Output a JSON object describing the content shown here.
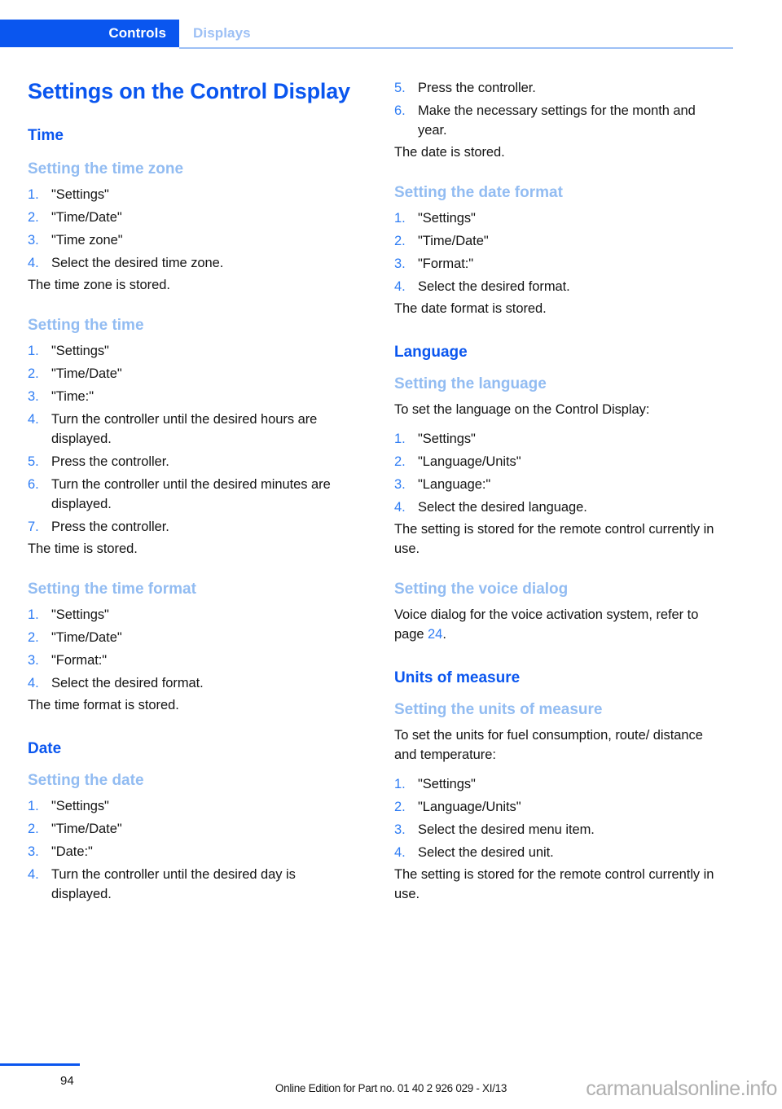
{
  "header": {
    "active_tab": "Controls",
    "inactive_tab": "Displays"
  },
  "colors": {
    "accent_blue": "#0a56ef",
    "light_blue": "#92bcf2",
    "number_blue": "#2f7df4",
    "body_text": "#141414",
    "watermark_gray": "#b0b0b0"
  },
  "title": "Settings on the Control Display",
  "left_column": {
    "section_time": "Time",
    "sub_time_zone": {
      "heading": "Setting the time zone",
      "steps": [
        {
          "num": "1.",
          "text": "\"Settings\""
        },
        {
          "num": "2.",
          "text": "\"Time/Date\""
        },
        {
          "num": "3.",
          "text": "\"Time zone\""
        },
        {
          "num": "4.",
          "text": "Select the desired time zone."
        }
      ],
      "result": "The time zone is stored."
    },
    "sub_time": {
      "heading": "Setting the time",
      "steps": [
        {
          "num": "1.",
          "text": "\"Settings\""
        },
        {
          "num": "2.",
          "text": "\"Time/Date\""
        },
        {
          "num": "3.",
          "text": "\"Time:\""
        },
        {
          "num": "4.",
          "text": "Turn the controller until the desired hours are displayed."
        },
        {
          "num": "5.",
          "text": "Press the controller."
        },
        {
          "num": "6.",
          "text": "Turn the controller until the desired mi­nutes are displayed."
        },
        {
          "num": "7.",
          "text": "Press the controller."
        }
      ],
      "result": "The time is stored."
    },
    "sub_time_format": {
      "heading": "Setting the time format",
      "steps": [
        {
          "num": "1.",
          "text": "\"Settings\""
        },
        {
          "num": "2.",
          "text": "\"Time/Date\""
        },
        {
          "num": "3.",
          "text": "\"Format:\""
        },
        {
          "num": "4.",
          "text": "Select the desired format."
        }
      ],
      "result": "The time format is stored."
    },
    "section_date": "Date",
    "sub_date": {
      "heading": "Setting the date",
      "steps": [
        {
          "num": "1.",
          "text": "\"Settings\""
        },
        {
          "num": "2.",
          "text": "\"Time/Date\""
        },
        {
          "num": "3.",
          "text": "\"Date:\""
        },
        {
          "num": "4.",
          "text": "Turn the controller until the desired day is displayed."
        }
      ]
    }
  },
  "right_column": {
    "date_steps_continued": [
      {
        "num": "5.",
        "text": "Press the controller."
      },
      {
        "num": "6.",
        "text": "Make the necessary settings for the month and year."
      }
    ],
    "date_result": "The date is stored.",
    "sub_date_format": {
      "heading": "Setting the date format",
      "steps": [
        {
          "num": "1.",
          "text": "\"Settings\""
        },
        {
          "num": "2.",
          "text": "\"Time/Date\""
        },
        {
          "num": "3.",
          "text": "\"Format:\""
        },
        {
          "num": "4.",
          "text": "Select the desired format."
        }
      ],
      "result": "The date format is stored."
    },
    "section_language": "Language",
    "sub_language": {
      "heading": "Setting the language",
      "lead": "To set the language on the Control Display:",
      "steps": [
        {
          "num": "1.",
          "text": "\"Settings\""
        },
        {
          "num": "2.",
          "text": "\"Language/Units\""
        },
        {
          "num": "3.",
          "text": "\"Language:\""
        },
        {
          "num": "4.",
          "text": "Select the desired language."
        }
      ],
      "result": "The setting is stored for the remote control currently in use."
    },
    "sub_voice_dialog": {
      "heading": "Setting the voice dialog",
      "text_before": "Voice dialog for the voice activation system, refer to page ",
      "page_ref": "24",
      "text_after": "."
    },
    "section_units": "Units of measure",
    "sub_units": {
      "heading": "Setting the units of measure",
      "lead": "To set the units for fuel consumption, route/ distance and temperature:",
      "steps": [
        {
          "num": "1.",
          "text": "\"Settings\""
        },
        {
          "num": "2.",
          "text": "\"Language/Units\""
        },
        {
          "num": "3.",
          "text": "Select the desired menu item."
        },
        {
          "num": "4.",
          "text": "Select the desired unit."
        }
      ],
      "result": "The setting is stored for the remote control currently in use."
    }
  },
  "footer": {
    "page_number": "94",
    "edition": "Online Edition for Part no. 01 40 2 926 029 - XI/13",
    "watermark": "carmanualsonline.info"
  }
}
